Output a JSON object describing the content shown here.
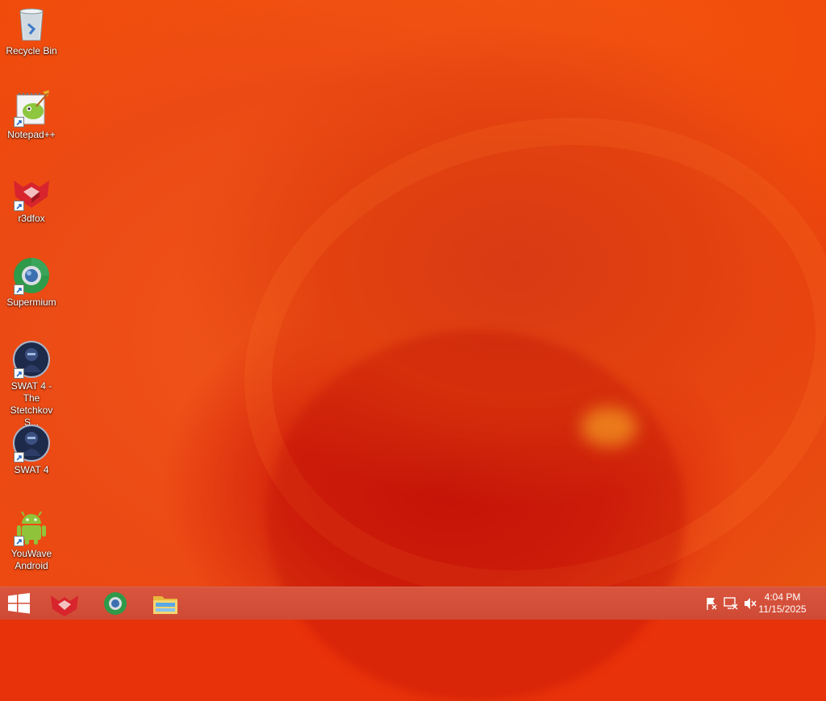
{
  "desktop": {
    "icons": [
      {
        "label": "Recycle Bin",
        "icon": "recycle-bin-icon"
      },
      {
        "label": "Notepad++",
        "icon": "notepadpp-icon"
      },
      {
        "label": "r3dfox",
        "icon": "r3dfox-icon"
      },
      {
        "label": "Supermium",
        "icon": "supermium-icon"
      },
      {
        "label": "SWAT 4 - The Stetchkov S...",
        "icon": "swat4-icon"
      },
      {
        "label": "SWAT 4",
        "icon": "swat4-icon"
      },
      {
        "label": "YouWave Android",
        "icon": "android-icon"
      }
    ]
  },
  "taskbar": {
    "start_icon": "windows-start-icon",
    "pinned": [
      {
        "icon": "r3dfox-icon"
      },
      {
        "icon": "supermium-icon"
      },
      {
        "icon": "file-explorer-icon"
      }
    ],
    "tray": [
      {
        "icon": "action-center-flag-icon"
      },
      {
        "icon": "network-icon"
      },
      {
        "icon": "volume-muted-icon"
      }
    ],
    "clock": {
      "time": "4:04 PM",
      "date": "11/15/2025"
    }
  },
  "colors": {
    "wallpaper_accent": "#ee4a10",
    "taskbar": "#d4503a"
  }
}
